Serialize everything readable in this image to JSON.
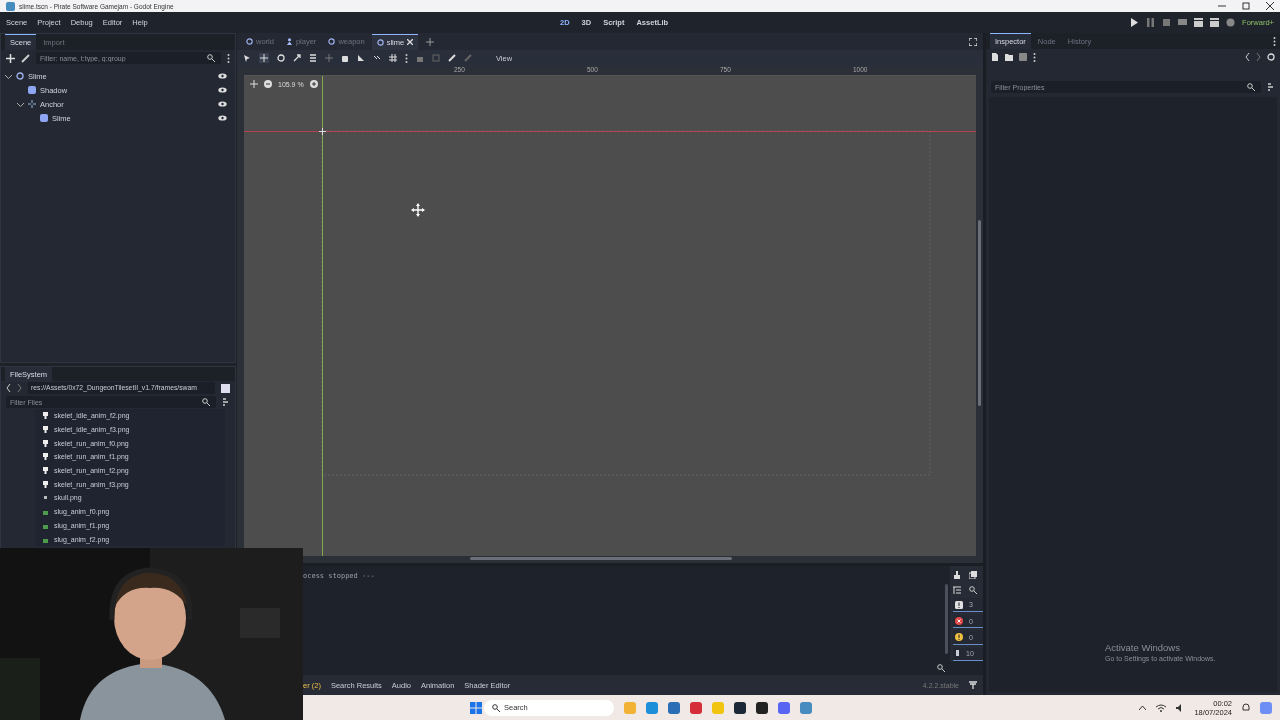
{
  "window": {
    "title": "slime.tscn - Pirate Software Gamejam - Godot Engine"
  },
  "menu": [
    "Scene",
    "Project",
    "Debug",
    "Editor",
    "Help"
  ],
  "workspaces": [
    {
      "label": "2D",
      "selected": true
    },
    {
      "label": "3D",
      "selected": false
    },
    {
      "label": "Script",
      "selected": false
    },
    {
      "label": "AssetLib",
      "selected": false
    }
  ],
  "renderer": "Forward+",
  "scene_dock": {
    "tabs": [
      {
        "label": "Scene",
        "selected": true
      },
      {
        "label": "Import",
        "selected": false
      }
    ],
    "filter": {
      "placeholder": "Filter: name, t:type, g:group"
    },
    "tree": [
      {
        "label": "Slime",
        "kind": "node",
        "expanded": true,
        "children": [
          {
            "label": "Shadow",
            "kind": "sprite"
          },
          {
            "label": "Anchor",
            "kind": "marker",
            "expanded": true,
            "children": [
              {
                "label": "Slime",
                "kind": "sprite"
              }
            ]
          }
        ]
      }
    ]
  },
  "filesystem": {
    "tab": "FileSystem",
    "path": "res://Assets/0x72_DungeonTilesetII_v1.7/frames/swam",
    "filter": {
      "placeholder": "Filter Files"
    },
    "files": [
      {
        "name": "skelet_idle_anim_f2.png",
        "kind": "skeleton"
      },
      {
        "name": "skelet_idle_anim_f3.png",
        "kind": "skeleton"
      },
      {
        "name": "skelet_run_anim_f0.png",
        "kind": "skeleton"
      },
      {
        "name": "skelet_run_anim_f1.png",
        "kind": "skeleton"
      },
      {
        "name": "skelet_run_anim_f2.png",
        "kind": "skeleton"
      },
      {
        "name": "skelet_run_anim_f3.png",
        "kind": "skeleton"
      },
      {
        "name": "skull.png",
        "kind": "skull"
      },
      {
        "name": "slug_anim_f0.png",
        "kind": "slug"
      },
      {
        "name": "slug_anim_f1.png",
        "kind": "slug"
      },
      {
        "name": "slug_anim_f2.png",
        "kind": "slug"
      }
    ]
  },
  "scene_tabs": [
    {
      "label": "world",
      "kind": "node",
      "selected": false
    },
    {
      "label": "player",
      "kind": "character",
      "selected": false
    },
    {
      "label": "weapon",
      "kind": "node",
      "selected": false
    },
    {
      "label": "slime",
      "kind": "node",
      "selected": true
    }
  ],
  "toolbar": {
    "view_menu": "View"
  },
  "viewport": {
    "zoom": "105.9 %",
    "ruler_labels": [
      "250",
      "500",
      "750",
      "1000"
    ]
  },
  "output": {
    "lines": [
      "ocess stopped ---"
    ],
    "counts": [
      {
        "kind": "info",
        "value": "3"
      },
      {
        "kind": "error",
        "value": "0"
      },
      {
        "kind": "warning",
        "value": "0"
      },
      {
        "kind": "message",
        "value": "10"
      }
    ]
  },
  "bottom_tabs": [
    "er (2)",
    "Search Results",
    "Audio",
    "Animation",
    "Shader Editor"
  ],
  "version": "4.2.2.stable",
  "inspector": {
    "tabs": [
      {
        "label": "Inspector",
        "selected": true
      },
      {
        "label": "Node",
        "selected": false
      },
      {
        "label": "History",
        "selected": false
      }
    ],
    "filter": {
      "placeholder": "Filter Properties"
    }
  },
  "activation_notice": {
    "title": "Activate Windows",
    "text": "Go to Settings to activate Windows."
  },
  "taskbar": {
    "search": {
      "placeholder": "Search"
    },
    "time": "00:02",
    "date": "18/07/2024"
  }
}
